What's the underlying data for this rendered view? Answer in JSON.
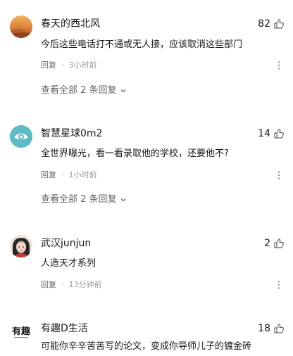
{
  "comments": [
    {
      "username": "春天的西北风",
      "likes": "82",
      "text": "今后这些电话打不通或无人接，应该取消这些部门",
      "reply_label": "回复",
      "time": "3小时前",
      "view_replies": "查看全部 2 条回复"
    },
    {
      "username": "智慧星球0m2",
      "likes": "14",
      "text": "全世界曝光，看一看录取他的学校，还要他不?",
      "reply_label": "回复",
      "time": "1小时前",
      "view_replies": "查看全部 2 条回复"
    },
    {
      "username": "武汉junjun",
      "likes": "2",
      "text": "人造天才系列",
      "reply_label": "回复",
      "time": "13分钟前"
    },
    {
      "username": "有趣D生活",
      "likes": "18",
      "text": "可能你辛辛苦苦写的论文，变成你导师儿子的镀金砖",
      "avatar_text": "有趣"
    }
  ],
  "icons": {
    "like": "thumbs-up-icon",
    "more": "more-dots-icon",
    "expand": "chevron-down-icon"
  }
}
